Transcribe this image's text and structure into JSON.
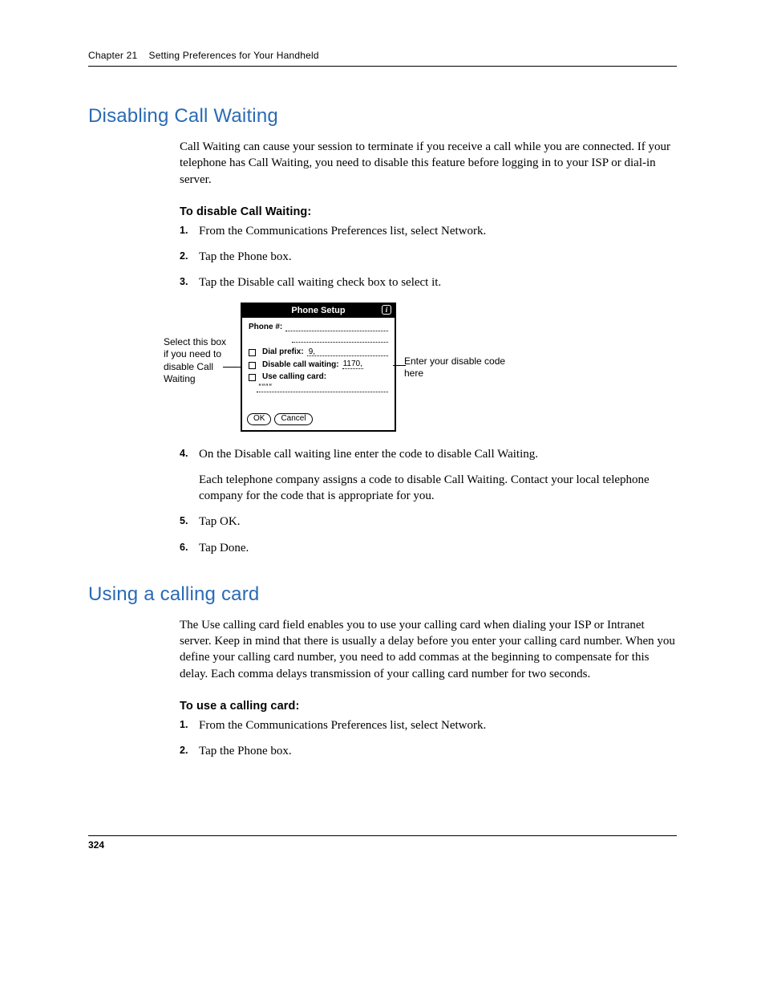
{
  "running_head": {
    "chapter": "Chapter 21",
    "title": "Setting Preferences for Your Handheld"
  },
  "section1": {
    "heading": "Disabling Call Waiting",
    "intro": "Call Waiting can cause your session to terminate if you receive a call while you are connected. If your telephone has Call Waiting, you need to disable this feature before logging in to your ISP or dial-in server.",
    "subhead": "To disable Call Waiting:",
    "steps": [
      "From the Communications Preferences list, select Network.",
      "Tap the Phone box.",
      "Tap the Disable call waiting check box to select it."
    ],
    "callout_left": "Select this box if you need to disable Call Waiting",
    "callout_right": "Enter your disable code here",
    "steps_after": [
      "On the Disable call waiting line enter the code to disable Call Waiting.",
      "Tap OK.",
      "Tap Done."
    ],
    "step4_extra": "Each telephone company assigns a code to disable Call Waiting. Contact your local telephone company for the code that is appropriate for you."
  },
  "pda": {
    "title": "Phone Setup",
    "phone_label": "Phone #:",
    "dial_prefix_label": "Dial prefix:",
    "dial_prefix_value": "9,",
    "disable_label": "Disable call waiting:",
    "disable_value": "1170,",
    "card_label": "Use calling card:",
    "card_value": "““““",
    "ok": "OK",
    "cancel": "Cancel",
    "info": "i"
  },
  "section2": {
    "heading": "Using a calling card",
    "intro": "The Use calling card field enables you to use your calling card when dialing your ISP or Intranet server. Keep in mind that there is usually a delay before you enter your calling card number. When you define your calling card number, you need to add commas at the beginning to compensate for this delay. Each comma delays transmission of your calling card number for two seconds.",
    "subhead": "To use a calling card:",
    "steps": [
      "From the Communications Preferences list, select Network.",
      "Tap the Phone box."
    ]
  },
  "page_number": "324"
}
